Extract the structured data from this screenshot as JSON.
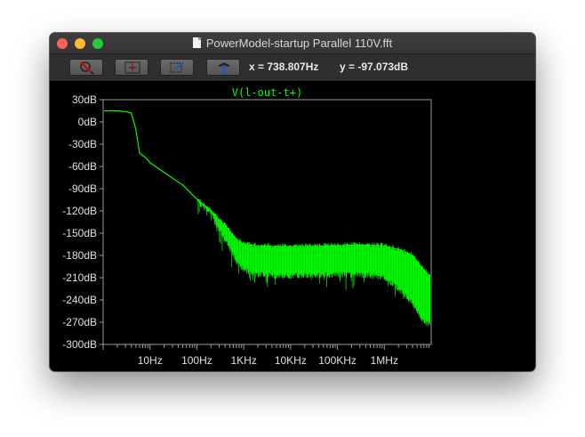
{
  "window": {
    "title": "PowerModel-startup Parallel 110V.fft"
  },
  "toolbar": {
    "buttons": [
      {
        "icon": "zoom-cancel-icon"
      },
      {
        "icon": "autorange-icon"
      },
      {
        "icon": "zoom-icon"
      },
      {
        "icon": "probe-icon"
      }
    ],
    "x_readout": "x = 738.807Hz",
    "y_readout": "y = -97.073dB"
  },
  "colors": {
    "trace": "#00ff00",
    "axis": "#9a9a9a",
    "label": "#e0e0e0",
    "background": "#000000"
  },
  "chart_data": {
    "type": "line",
    "title": "V(l-out-t+)",
    "xlabel": "",
    "ylabel": "",
    "x_scale": "log",
    "xlim": [
      1,
      10000000
    ],
    "ylim": [
      -300,
      30
    ],
    "y_ticks": [
      "30dB",
      "0dB",
      "-30dB",
      "-60dB",
      "-90dB",
      "-120dB",
      "-150dB",
      "-180dB",
      "-210dB",
      "-240dB",
      "-270dB",
      "-300dB"
    ],
    "y_tick_values": [
      30,
      0,
      -30,
      -60,
      -90,
      -120,
      -150,
      -180,
      -210,
      -240,
      -270,
      -300
    ],
    "x_ticks": [
      "10Hz",
      "100Hz",
      "1KHz",
      "10KHz",
      "100KHz",
      "1MHz"
    ],
    "x_tick_values": [
      10,
      100,
      1000,
      10000,
      100000,
      1000000
    ],
    "grid": false,
    "series": [
      {
        "name": "V(l-out-t+)",
        "x": [
          1,
          2,
          3,
          4,
          5,
          6,
          8,
          10,
          20,
          50,
          100,
          200,
          400,
          739,
          1000,
          2000,
          5000,
          10000,
          30000,
          100000,
          300000,
          1000000,
          2000000,
          4000000,
          6000000,
          10000000
        ],
        "y": [
          15,
          15,
          14,
          12,
          -10,
          -42,
          -48,
          -55,
          -68,
          -85,
          -104,
          -120,
          -140,
          -160,
          -165,
          -167,
          -168,
          -168,
          -168,
          -167,
          -166,
          -167,
          -172,
          -180,
          -195,
          -210
        ],
        "noise_floor_y": [
          null,
          null,
          null,
          null,
          null,
          null,
          null,
          null,
          null,
          null,
          -106,
          -125,
          -160,
          -190,
          -200,
          -205,
          -208,
          -208,
          -207,
          -206,
          -206,
          -210,
          -225,
          -245,
          -265,
          -275
        ]
      }
    ]
  }
}
